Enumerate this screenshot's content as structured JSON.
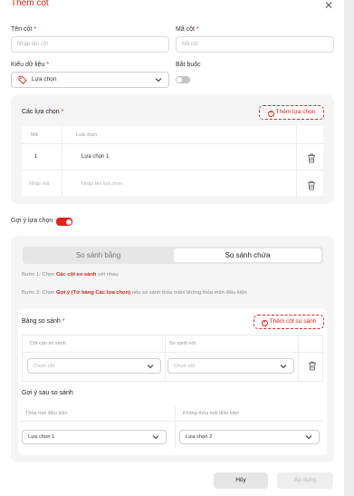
{
  "modal": {
    "title": "Thêm cột",
    "close_icon": "close-icon"
  },
  "form": {
    "column_name": {
      "label": "Tên cột",
      "placeholder": "Nhập tên cột"
    },
    "column_code": {
      "label": "Mã cột",
      "placeholder": "Mã cột"
    },
    "data_type": {
      "label": "Kiểu dữ liệu",
      "value": "Lựa chọn",
      "icon": "tag-icon"
    },
    "required": {
      "label": "Bắt buộc",
      "on": false
    }
  },
  "options_section": {
    "title": "Các lựa chọn",
    "add_button": "Thêm lựa chọn",
    "columns": [
      "Mã",
      "Lựa chọn"
    ],
    "rows": [
      {
        "code": "1",
        "label": "Lựa chọn 1"
      }
    ],
    "new_row": {
      "code_placeholder": "Nhập mã",
      "label_placeholder": "Nhập tên lựa chọn"
    }
  },
  "suggest": {
    "label": "Gợi ý lựa chọn",
    "on": true,
    "tabs": [
      "So sánh bằng",
      "So sánh chứa"
    ],
    "active_tab": 1,
    "step1": {
      "prefix": "Bước 1: Chọn ",
      "highlight": "Các cột so sánh",
      "suffix": " với nhau"
    },
    "step2": {
      "prefix": "Bước 2: Chọn ",
      "highlight": "Gợi ý (Từ bảng Các lựa chọn)",
      "suffix": " nếu so sánh thỏa mãn/ không thỏa mãn điều kiện"
    },
    "compare_table": {
      "title": "Bảng so sánh",
      "add_button": "Thêm cột so sánh",
      "columns": [
        "Cột cần so sánh",
        "So sánh với"
      ],
      "placeholders": [
        "Chọn cột",
        "Chọn cột"
      ]
    },
    "after_compare": {
      "title": "Gợi ý sau so sánh",
      "columns": [
        "Thỏa mãi điều kiện",
        "Không thỏa mãi điều kiện"
      ],
      "values": [
        "Lựa chọn 1",
        "Lựa chọn 2"
      ]
    }
  },
  "footer": {
    "cancel": "Hủy",
    "apply": "Áp dụng"
  },
  "colors": {
    "accent": "#e2231a",
    "topbar": "#f5c400"
  }
}
